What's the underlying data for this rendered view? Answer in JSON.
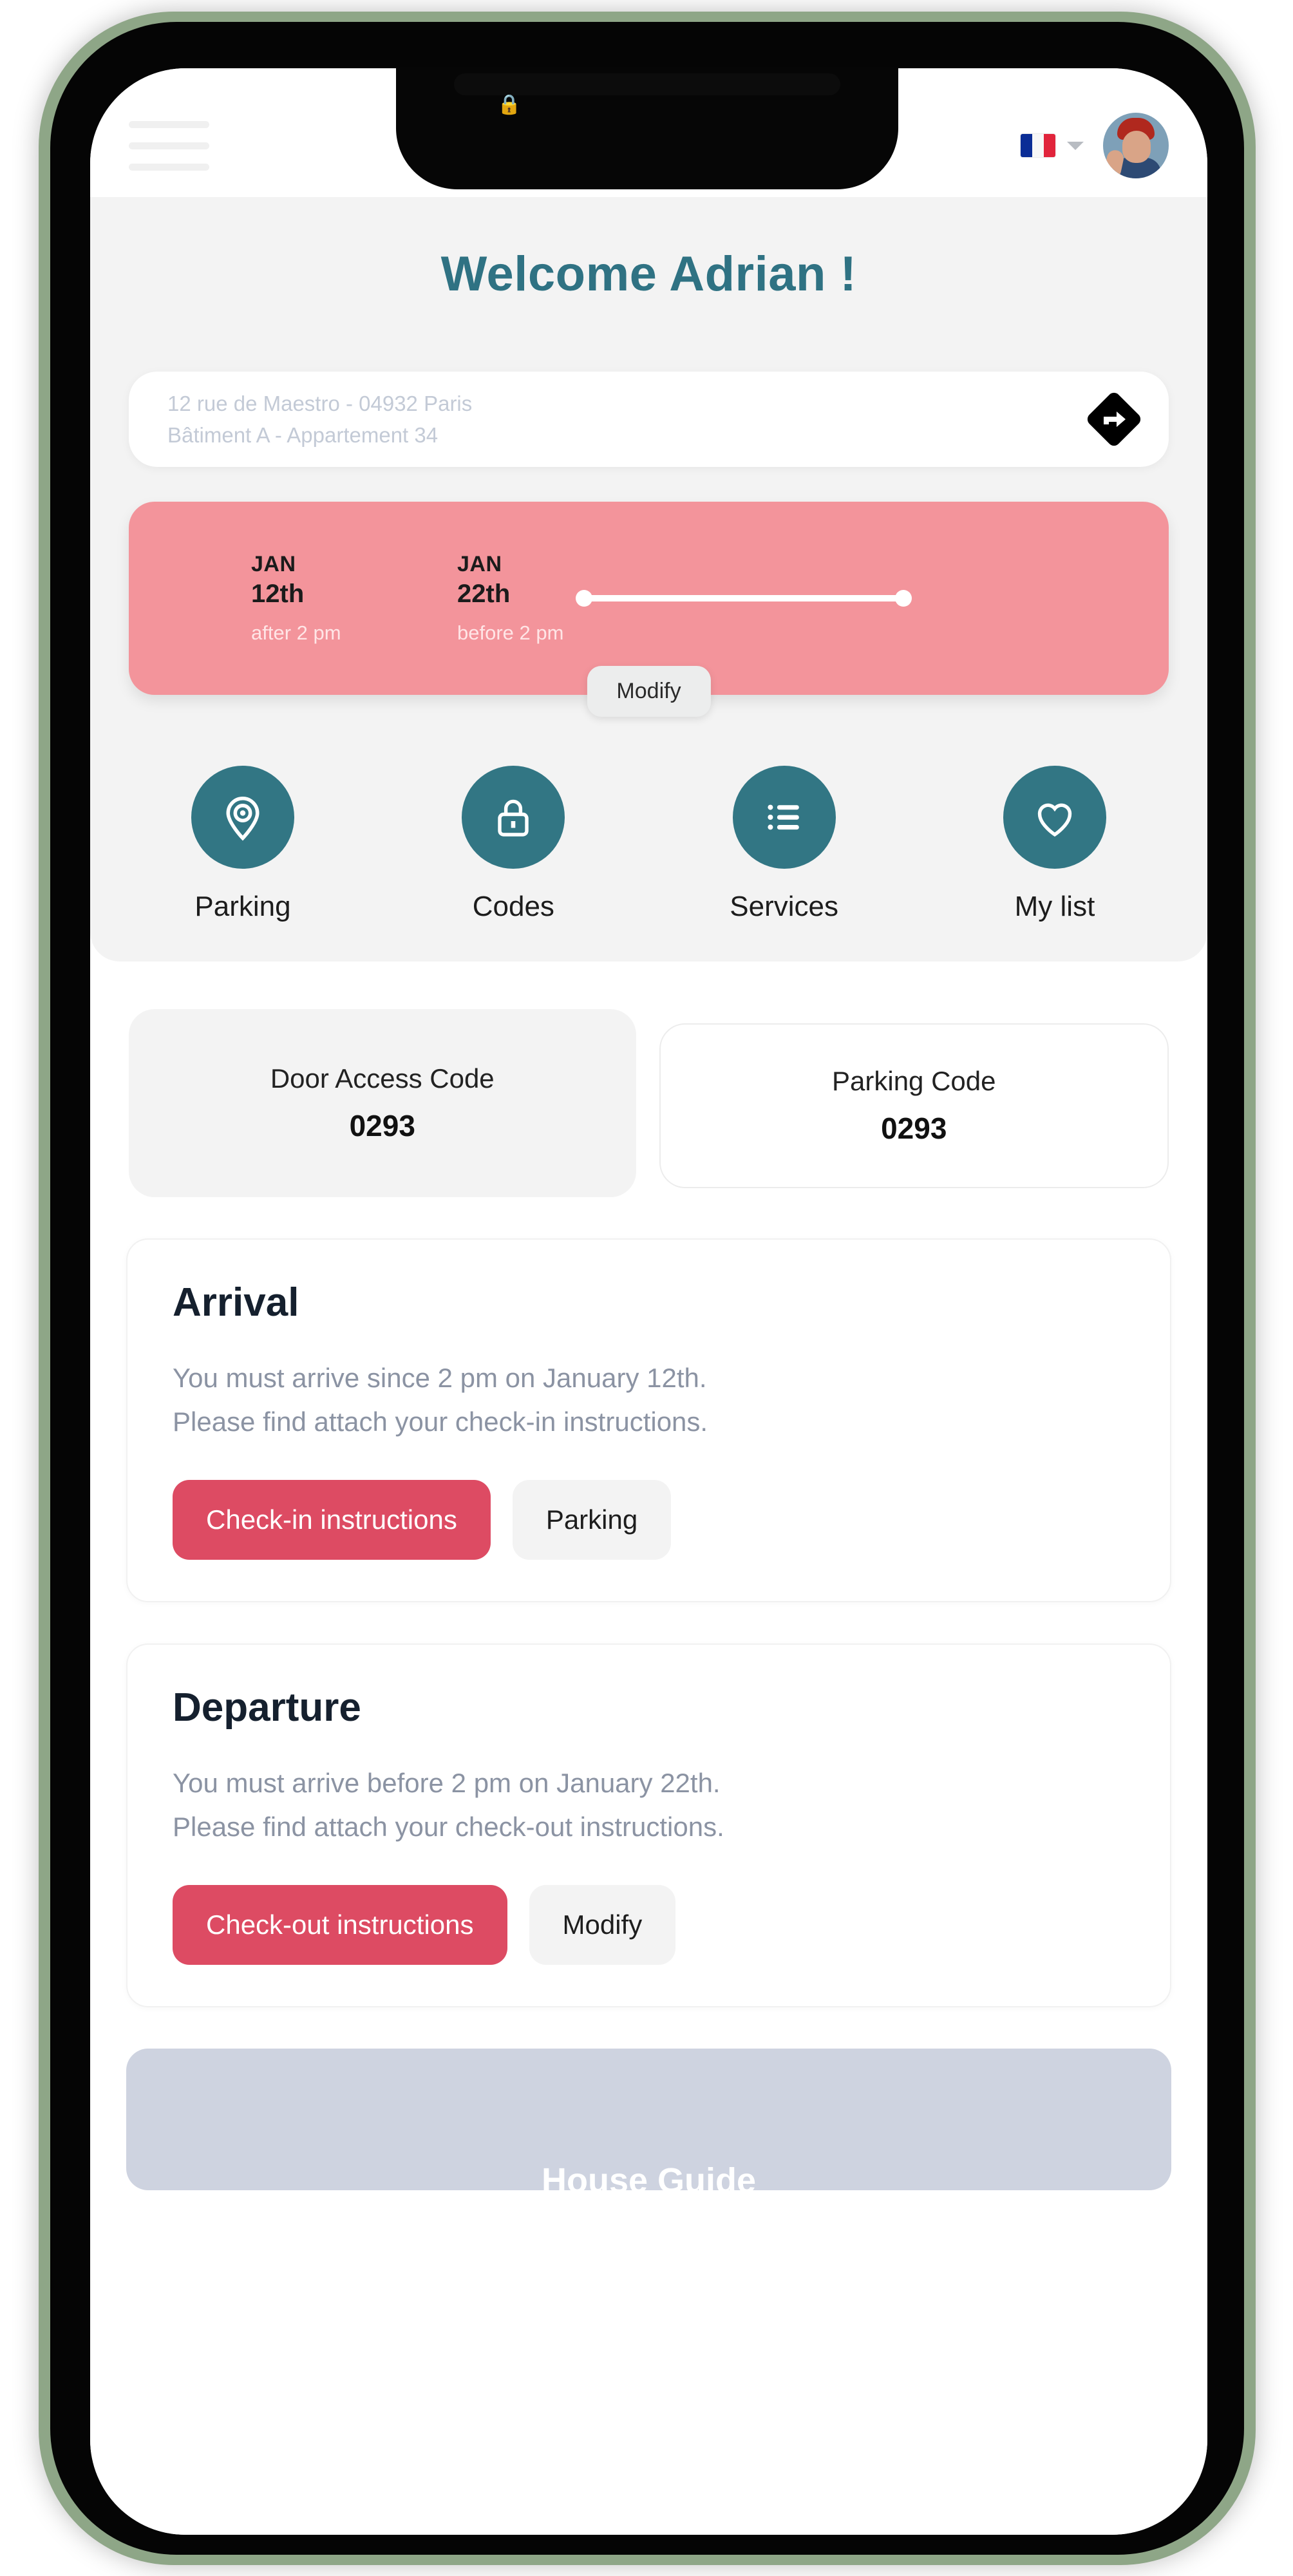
{
  "header": {
    "menu_icon": "hamburger-menu-icon",
    "language": {
      "flag": "flag-france",
      "code": "FR"
    },
    "avatar_alt": "user-avatar"
  },
  "page_title": "Welcome Adrian !",
  "address": {
    "line1": "12 rue de Maestro - 04932 Paris",
    "line2": "Bâtiment A - Appartement 34",
    "directions_icon": "directions-icon"
  },
  "stay": {
    "start": {
      "month": "JAN",
      "day": "12th",
      "note": "after 2 pm"
    },
    "end": {
      "month": "JAN",
      "day": "22th",
      "note": "before 2 pm"
    },
    "modify_label": "Modify"
  },
  "quick_actions": [
    {
      "label": "Parking",
      "icon": "location-pin-icon"
    },
    {
      "label": "Codes",
      "icon": "lock-icon"
    },
    {
      "label": "Services",
      "icon": "list-icon"
    },
    {
      "label": "My list",
      "icon": "heart-icon"
    }
  ],
  "codes": [
    {
      "title": "Door Access Code",
      "value": "0293"
    },
    {
      "title": "Parking Code",
      "value": "0293"
    }
  ],
  "arrival": {
    "heading": "Arrival",
    "line1": "You must arrive since 2 pm on January 12th.",
    "line2": "Please find attach your check-in instructions.",
    "primary_button": "Check-in instructions",
    "secondary_button": "Parking"
  },
  "departure": {
    "heading": "Departure",
    "line1": "You must arrive before 2 pm on January 22th.",
    "line2": "Please find attach your check-out instructions.",
    "primary_button": "Check-out instructions",
    "secondary_button": "Modify"
  },
  "bottom_card": {
    "title": "House Guide"
  },
  "colors": {
    "teal": "#327684",
    "pink_card": "#f3949b",
    "primary_red": "#dd4b63",
    "title_teal": "#2f7283",
    "body_grey": "#8b93a3",
    "phone_frame": "#8ea687"
  }
}
